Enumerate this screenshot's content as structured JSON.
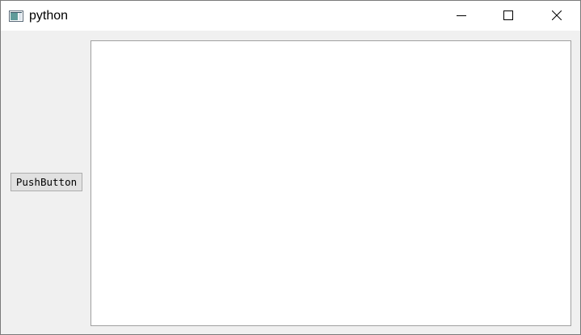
{
  "window": {
    "title": "python",
    "app_icon": "qt-window-icon",
    "controls": {
      "minimize_icon": "minimize-icon",
      "maximize_icon": "maximize-icon",
      "close_icon": "close-icon"
    }
  },
  "content": {
    "push_button_label": "PushButton"
  },
  "colors": {
    "window_background": "#f0f0f0",
    "titlebar_background": "#ffffff",
    "canvas_background": "#ffffff",
    "button_background": "#e1e1e1",
    "button_border": "#adadad"
  }
}
